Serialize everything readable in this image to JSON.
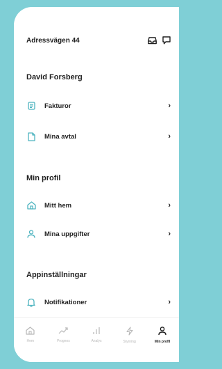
{
  "header": {
    "address": "Adressvägen 44"
  },
  "user": {
    "name": "David Forsberg"
  },
  "account_items": [
    {
      "label": "Fakturor"
    },
    {
      "label": "Mina avtal"
    }
  ],
  "profile": {
    "title": "Min profil",
    "items": [
      {
        "label": "Mitt hem"
      },
      {
        "label": "Mina uppgifter"
      }
    ]
  },
  "settings": {
    "title": "Appinställningar",
    "items": [
      {
        "label": "Notifikationer"
      }
    ]
  },
  "tabbar": {
    "tabs": [
      {
        "label": "Hem",
        "icon": "home-icon"
      },
      {
        "label": "Prognos",
        "icon": "trend-icon"
      },
      {
        "label": "Analys",
        "icon": "bar-chart-icon"
      },
      {
        "label": "Styrning",
        "icon": "bolt-icon"
      },
      {
        "label": "Min profil",
        "icon": "person-icon"
      }
    ]
  },
  "colors": {
    "accent": "#4db3bf",
    "background": "#7fcfd6",
    "text": "#1f1f1f",
    "tab_inactive": "#b8b8b8"
  }
}
